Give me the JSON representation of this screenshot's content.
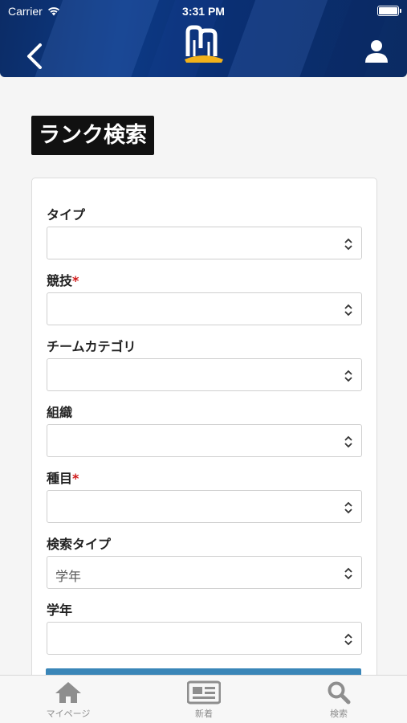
{
  "status_bar": {
    "carrier": "Carrier",
    "time": "3:31 PM"
  },
  "header": {
    "back_icon": "chevron-left-icon",
    "logo_icon": "brand-logo",
    "user_icon": "person-icon",
    "colors": {
      "primary": "#0d3a86",
      "logo_accent": "#f2b21b"
    }
  },
  "page": {
    "title": "ランク検索"
  },
  "form": {
    "fields": [
      {
        "label": "タイプ",
        "required": false,
        "value": ""
      },
      {
        "label": "競技",
        "required": true,
        "value": ""
      },
      {
        "label": "チームカテゴリ",
        "required": false,
        "value": ""
      },
      {
        "label": "組織",
        "required": false,
        "value": ""
      },
      {
        "label": "種目",
        "required": true,
        "value": ""
      },
      {
        "label": "検索タイプ",
        "required": false,
        "value": "学年"
      },
      {
        "label": "学年",
        "required": false,
        "value": ""
      }
    ],
    "required_mark": "*",
    "required_color": "#d01818",
    "submit_color": "#3a86b8"
  },
  "tabbar": {
    "tabs": [
      {
        "label": "マイページ",
        "icon": "home-icon"
      },
      {
        "label": "新着",
        "icon": "news-icon"
      },
      {
        "label": "検索",
        "icon": "search-icon"
      }
    ]
  }
}
